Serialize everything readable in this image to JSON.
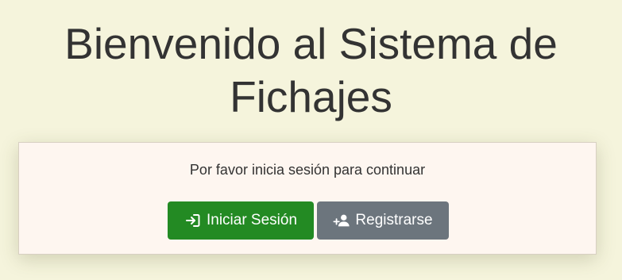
{
  "header": {
    "title_line1": "Bienvenido al Sistema de",
    "title_line2": "Fichajes"
  },
  "card": {
    "message": "Por favor inicia sesión para continuar",
    "login_label": "Iniciar Sesión",
    "register_label": "Registrarse"
  },
  "icons": {
    "login": "sign-in-icon",
    "register": "person-plus-icon"
  },
  "colors": {
    "background": "#f5f4dc",
    "card_background": "#fef6f0",
    "login_button": "#238a23",
    "register_button": "#6c757d",
    "text": "#333333"
  }
}
